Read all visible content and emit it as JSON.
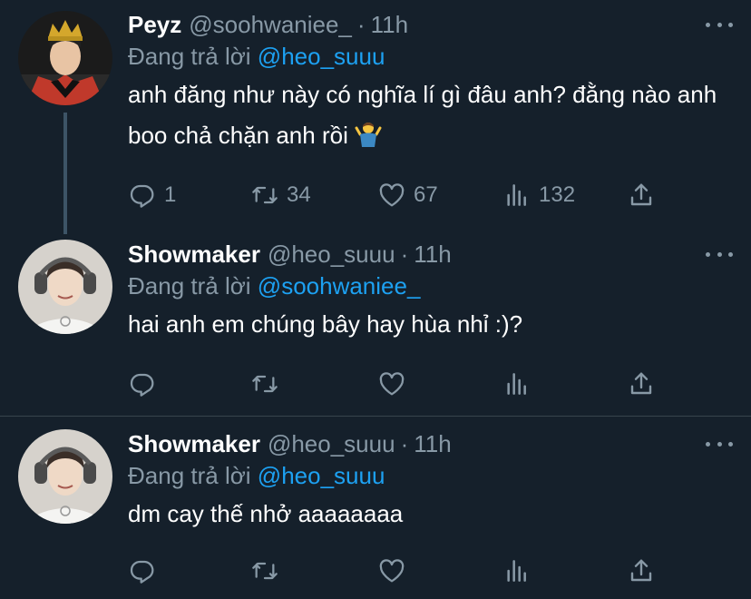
{
  "tweets": [
    {
      "name": "Peyz",
      "handle": "@soohwaniee_",
      "dot": "·",
      "time": "11h",
      "reply_prefix": "Đang trả lời",
      "reply_to": "@heo_suuu",
      "text": "anh đăng như này có nghĩa lí gì đâu anh? đằng nào anh boo chả chặn anh rồi",
      "emoji": "person-shrugging",
      "counts": {
        "reply": "1",
        "retweet": "34",
        "like": "67",
        "views": "132"
      }
    },
    {
      "name": "Showmaker",
      "handle": "@heo_suuu",
      "dot": "·",
      "time": "11h",
      "reply_prefix": "Đang trả lời",
      "reply_to": "@soohwaniee_",
      "text": "hai anh em chúng bây hay hùa nhỉ :)?",
      "counts": {
        "reply": "",
        "retweet": "",
        "like": "",
        "views": ""
      }
    },
    {
      "name": "Showmaker",
      "handle": "@heo_suuu",
      "dot": "·",
      "time": "11h",
      "reply_prefix": "Đang trả lời",
      "reply_to": "@heo_suuu",
      "text": "dm cay thế nhở aaaaaaaa",
      "counts": {
        "reply": "",
        "retweet": "",
        "like": "",
        "views": ""
      }
    }
  ],
  "colors": {
    "background": "#15202b",
    "secondary_text": "#8899a6",
    "accent": "#1da1f2",
    "divider": "#38444d"
  },
  "icons": [
    "reply-icon",
    "retweet-icon",
    "like-icon",
    "views-icon",
    "share-icon",
    "more-icon"
  ]
}
